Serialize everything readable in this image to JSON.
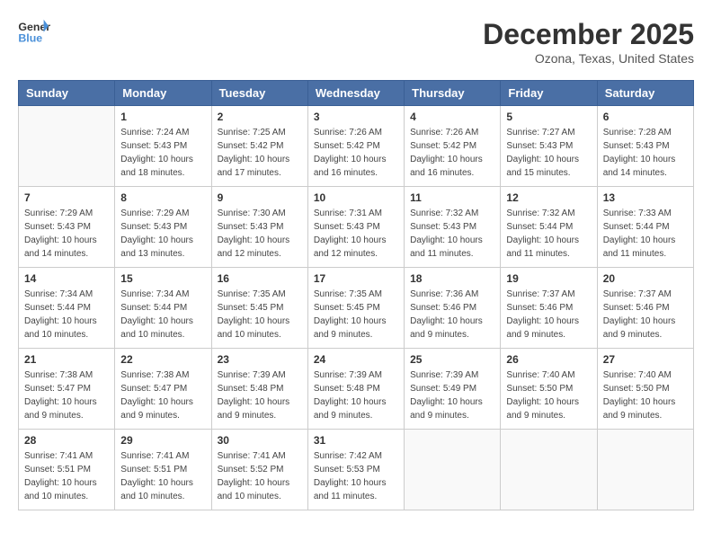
{
  "header": {
    "logo_line1": "General",
    "logo_line2": "Blue",
    "month": "December 2025",
    "location": "Ozona, Texas, United States"
  },
  "days_of_week": [
    "Sunday",
    "Monday",
    "Tuesday",
    "Wednesday",
    "Thursday",
    "Friday",
    "Saturday"
  ],
  "weeks": [
    [
      {
        "num": "",
        "sunrise": "",
        "sunset": "",
        "daylight": ""
      },
      {
        "num": "1",
        "sunrise": "7:24 AM",
        "sunset": "5:43 PM",
        "daylight": "10 hours and 18 minutes."
      },
      {
        "num": "2",
        "sunrise": "7:25 AM",
        "sunset": "5:42 PM",
        "daylight": "10 hours and 17 minutes."
      },
      {
        "num": "3",
        "sunrise": "7:26 AM",
        "sunset": "5:42 PM",
        "daylight": "10 hours and 16 minutes."
      },
      {
        "num": "4",
        "sunrise": "7:26 AM",
        "sunset": "5:42 PM",
        "daylight": "10 hours and 16 minutes."
      },
      {
        "num": "5",
        "sunrise": "7:27 AM",
        "sunset": "5:43 PM",
        "daylight": "10 hours and 15 minutes."
      },
      {
        "num": "6",
        "sunrise": "7:28 AM",
        "sunset": "5:43 PM",
        "daylight": "10 hours and 14 minutes."
      }
    ],
    [
      {
        "num": "7",
        "sunrise": "7:29 AM",
        "sunset": "5:43 PM",
        "daylight": "10 hours and 14 minutes."
      },
      {
        "num": "8",
        "sunrise": "7:29 AM",
        "sunset": "5:43 PM",
        "daylight": "10 hours and 13 minutes."
      },
      {
        "num": "9",
        "sunrise": "7:30 AM",
        "sunset": "5:43 PM",
        "daylight": "10 hours and 12 minutes."
      },
      {
        "num": "10",
        "sunrise": "7:31 AM",
        "sunset": "5:43 PM",
        "daylight": "10 hours and 12 minutes."
      },
      {
        "num": "11",
        "sunrise": "7:32 AM",
        "sunset": "5:43 PM",
        "daylight": "10 hours and 11 minutes."
      },
      {
        "num": "12",
        "sunrise": "7:32 AM",
        "sunset": "5:44 PM",
        "daylight": "10 hours and 11 minutes."
      },
      {
        "num": "13",
        "sunrise": "7:33 AM",
        "sunset": "5:44 PM",
        "daylight": "10 hours and 11 minutes."
      }
    ],
    [
      {
        "num": "14",
        "sunrise": "7:34 AM",
        "sunset": "5:44 PM",
        "daylight": "10 hours and 10 minutes."
      },
      {
        "num": "15",
        "sunrise": "7:34 AM",
        "sunset": "5:44 PM",
        "daylight": "10 hours and 10 minutes."
      },
      {
        "num": "16",
        "sunrise": "7:35 AM",
        "sunset": "5:45 PM",
        "daylight": "10 hours and 10 minutes."
      },
      {
        "num": "17",
        "sunrise": "7:35 AM",
        "sunset": "5:45 PM",
        "daylight": "10 hours and 9 minutes."
      },
      {
        "num": "18",
        "sunrise": "7:36 AM",
        "sunset": "5:46 PM",
        "daylight": "10 hours and 9 minutes."
      },
      {
        "num": "19",
        "sunrise": "7:37 AM",
        "sunset": "5:46 PM",
        "daylight": "10 hours and 9 minutes."
      },
      {
        "num": "20",
        "sunrise": "7:37 AM",
        "sunset": "5:46 PM",
        "daylight": "10 hours and 9 minutes."
      }
    ],
    [
      {
        "num": "21",
        "sunrise": "7:38 AM",
        "sunset": "5:47 PM",
        "daylight": "10 hours and 9 minutes."
      },
      {
        "num": "22",
        "sunrise": "7:38 AM",
        "sunset": "5:47 PM",
        "daylight": "10 hours and 9 minutes."
      },
      {
        "num": "23",
        "sunrise": "7:39 AM",
        "sunset": "5:48 PM",
        "daylight": "10 hours and 9 minutes."
      },
      {
        "num": "24",
        "sunrise": "7:39 AM",
        "sunset": "5:48 PM",
        "daylight": "10 hours and 9 minutes."
      },
      {
        "num": "25",
        "sunrise": "7:39 AM",
        "sunset": "5:49 PM",
        "daylight": "10 hours and 9 minutes."
      },
      {
        "num": "26",
        "sunrise": "7:40 AM",
        "sunset": "5:50 PM",
        "daylight": "10 hours and 9 minutes."
      },
      {
        "num": "27",
        "sunrise": "7:40 AM",
        "sunset": "5:50 PM",
        "daylight": "10 hours and 9 minutes."
      }
    ],
    [
      {
        "num": "28",
        "sunrise": "7:41 AM",
        "sunset": "5:51 PM",
        "daylight": "10 hours and 10 minutes."
      },
      {
        "num": "29",
        "sunrise": "7:41 AM",
        "sunset": "5:51 PM",
        "daylight": "10 hours and 10 minutes."
      },
      {
        "num": "30",
        "sunrise": "7:41 AM",
        "sunset": "5:52 PM",
        "daylight": "10 hours and 10 minutes."
      },
      {
        "num": "31",
        "sunrise": "7:42 AM",
        "sunset": "5:53 PM",
        "daylight": "10 hours and 11 minutes."
      },
      {
        "num": "",
        "sunrise": "",
        "sunset": "",
        "daylight": ""
      },
      {
        "num": "",
        "sunrise": "",
        "sunset": "",
        "daylight": ""
      },
      {
        "num": "",
        "sunrise": "",
        "sunset": "",
        "daylight": ""
      }
    ]
  ]
}
